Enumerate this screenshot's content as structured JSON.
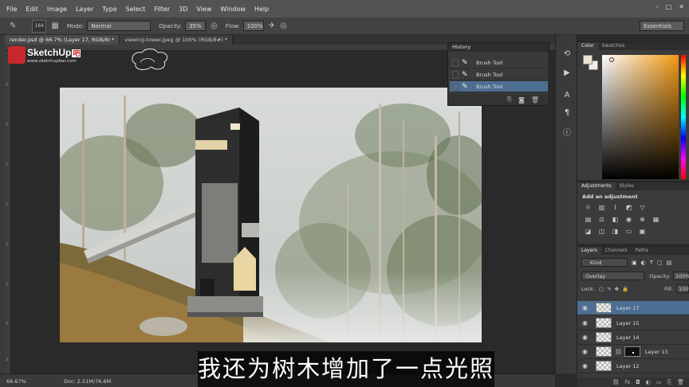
{
  "menu": [
    "File",
    "Edit",
    "Image",
    "Layer",
    "Type",
    "Select",
    "Filter",
    "3D",
    "View",
    "Window",
    "Help"
  ],
  "window_controls": [
    "–",
    "□",
    "✕"
  ],
  "options": {
    "brush_size": "164",
    "mode_label": "Mode:",
    "mode_value": "Normal",
    "opacity_label": "Opacity:",
    "opacity_value": "35%",
    "flow_label": "Flow:",
    "flow_value": "100%",
    "workspace": "Essentials"
  },
  "tabs": [
    {
      "label": "render.psd @ 66.7% (Layer 17, RGB/8) *",
      "active": true
    },
    {
      "label": "viewing-tower.jpeg @ 100% (RGB/8#) *",
      "active": false
    }
  ],
  "logo": {
    "name": "SketchUp",
    "badge": "吧",
    "url": "www.sketchupbar.com"
  },
  "ruler_marks": [
    "0",
    "5",
    "1",
    "1",
    "2",
    "2",
    "3",
    "3"
  ],
  "history": {
    "title": "History",
    "items": [
      "Brush Tool",
      "Brush Tool",
      "Brush Tool"
    ],
    "selected_index": 2
  },
  "color_panel": {
    "tabs": [
      "Color",
      "Swatches"
    ],
    "fg": "#ece3cf",
    "bg": "#f3efe6"
  },
  "adjustments": {
    "tabs": [
      "Adjustments",
      "Styles"
    ],
    "title": "Add an adjustment"
  },
  "layers": {
    "tabs": [
      "Layers",
      "Channels",
      "Paths"
    ],
    "kind": "Kind",
    "blend_mode": "Overlay",
    "opacity_label": "Opacity:",
    "opacity_value": "100%",
    "lock_label": "Lock:",
    "fill_label": "Fill:",
    "fill_value": "100%",
    "items": [
      {
        "name": "Layer 17",
        "selected": true,
        "mask": false
      },
      {
        "name": "Layer 15",
        "selected": false,
        "mask": false
      },
      {
        "name": "Layer 14",
        "selected": false,
        "mask": false
      },
      {
        "name": "Layer 13",
        "selected": false,
        "mask": true
      },
      {
        "name": "Layer 12",
        "selected": false,
        "mask": false
      }
    ]
  },
  "status": {
    "zoom": "66.67%",
    "doc": "Doc: 2.51M/76.6M"
  },
  "subtitle": "我还为树木增加了一点光照"
}
